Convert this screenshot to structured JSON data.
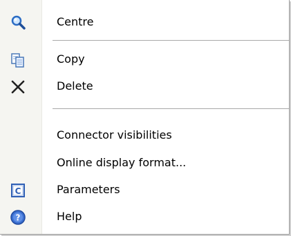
{
  "menu": {
    "items": [
      {
        "id": "centre",
        "label": "Centre",
        "icon": "magnifier-icon"
      },
      {
        "id": "copy",
        "label": "Copy",
        "icon": "copy-icon"
      },
      {
        "id": "delete",
        "label": "Delete",
        "icon": "delete-x-icon"
      },
      {
        "id": "connector",
        "label": "Connector visibilities",
        "icon": ""
      },
      {
        "id": "online",
        "label": "Online display format...",
        "icon": ""
      },
      {
        "id": "parameters",
        "label": "Parameters",
        "icon": "parameters-c-icon"
      },
      {
        "id": "help",
        "label": "Help",
        "icon": "help-question-icon"
      }
    ]
  },
  "colors": {
    "gutter": "#f5f5f1",
    "separator": "#a8a8a8",
    "icon_blue": "#2f5fb5"
  }
}
